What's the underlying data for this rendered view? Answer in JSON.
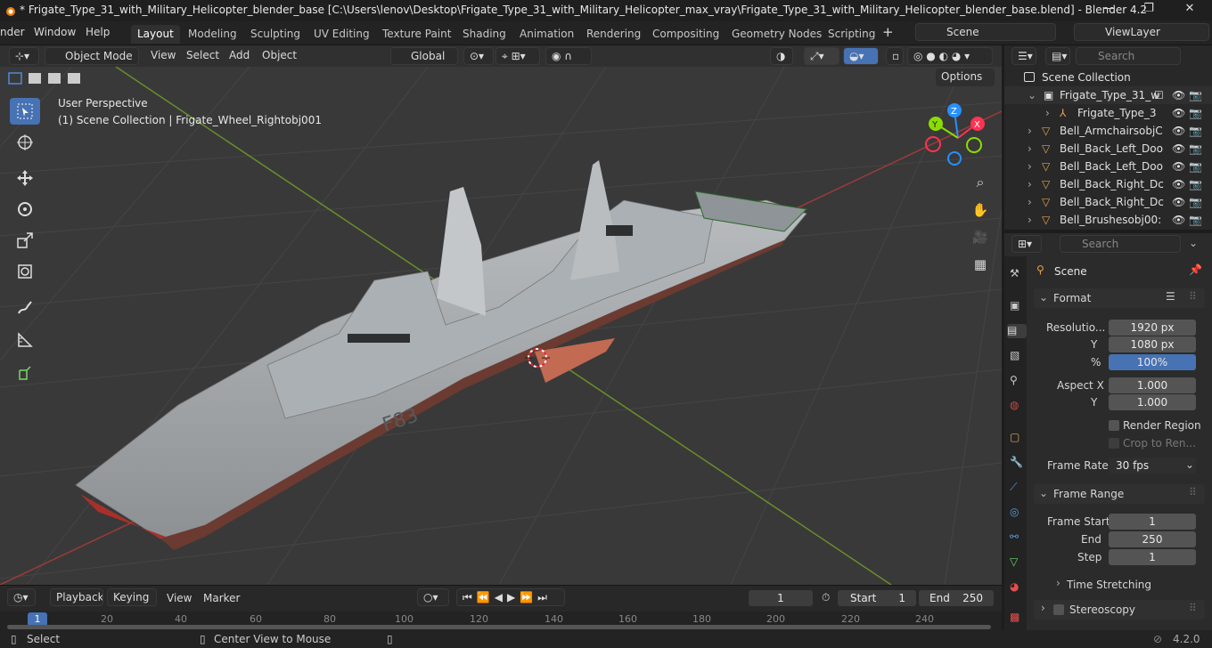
{
  "titlebar": {
    "title": "* Frigate_Type_31_with_Military_Helicopter_blender_base [C:\\Users\\lenov\\Desktop\\Frigate_Type_31_with_Military_Helicopter_max_vray\\Frigate_Type_31_with_Military_Helicopter_blender_base.blend] - Blender 4.2",
    "minimize": "—",
    "maximize": "❐",
    "close": "✕"
  },
  "menu": {
    "render": "nder",
    "window": "Window",
    "help": "Help"
  },
  "workspaces": [
    "Layout",
    "Modeling",
    "Sculpting",
    "UV Editing",
    "Texture Paint",
    "Shading",
    "Animation",
    "Rendering",
    "Compositing",
    "Geometry Nodes",
    "Scripting"
  ],
  "add_workspace": "+",
  "scene": {
    "label": "Scene",
    "viewlayer": "ViewLayer"
  },
  "viewport_header": {
    "mode": "Object Mode",
    "view": "View",
    "select": "Select",
    "add": "Add",
    "object": "Object",
    "orientation": "Global",
    "options": "Options"
  },
  "viewport": {
    "perspective": "User Perspective",
    "collection_info": "(1) Scene Collection | Frigate_Wheel_Rightobj001",
    "hull_number": "F83",
    "gizmo": {
      "x": "X",
      "y": "Y",
      "z": "Z"
    }
  },
  "outliner": {
    "search_placeholder": "Search",
    "root": "Scene Collection",
    "items": [
      "Frigate_Type_31_w",
      "Frigate_Type_3",
      "Bell_ArmchairsobjC",
      "Bell_Back_Left_Doo",
      "Bell_Back_Left_Doo",
      "Bell_Back_Right_Dc",
      "Bell_Back_Right_Dc",
      "Bell_Brushesobj00:"
    ]
  },
  "properties": {
    "search_placeholder": "Search",
    "context": "Scene",
    "format_panel": "Format",
    "resolution_x_label": "Resolutio...",
    "resolution_x": "1920 px",
    "resolution_y_label": "Y",
    "resolution_y": "1080 px",
    "percent_label": "%",
    "percent": "100%",
    "aspect_x_label": "Aspect X",
    "aspect_x": "1.000",
    "aspect_y_label": "Y",
    "aspect_y": "1.000",
    "render_region": "Render Region",
    "crop": "Crop to Ren...",
    "frame_rate_label": "Frame Rate",
    "frame_rate": "30 fps",
    "frame_range_panel": "Frame Range",
    "frame_start_label": "Frame Start",
    "frame_start": "1",
    "end_label": "End",
    "end": "250",
    "step_label": "Step",
    "step": "1",
    "time_stretching": "Time Stretching",
    "stereoscopy": "Stereoscopy"
  },
  "timeline": {
    "playback": "Playback",
    "keying": "Keying",
    "view": "View",
    "marker": "Marker",
    "current_frame": "1",
    "start_label": "Start",
    "start": "1",
    "end_label": "End",
    "end": "250",
    "ticks": [
      "1",
      "20",
      "40",
      "60",
      "80",
      "100",
      "120",
      "140",
      "160",
      "180",
      "200",
      "220",
      "240"
    ]
  },
  "status": {
    "select": "Select",
    "center_view": "Center View to Mouse",
    "version": "4.2.0"
  },
  "colors": {
    "accent": "#4772b3",
    "x_axis": "#ff3352",
    "y_axis": "#8bdc00",
    "z_axis": "#2890ff"
  }
}
